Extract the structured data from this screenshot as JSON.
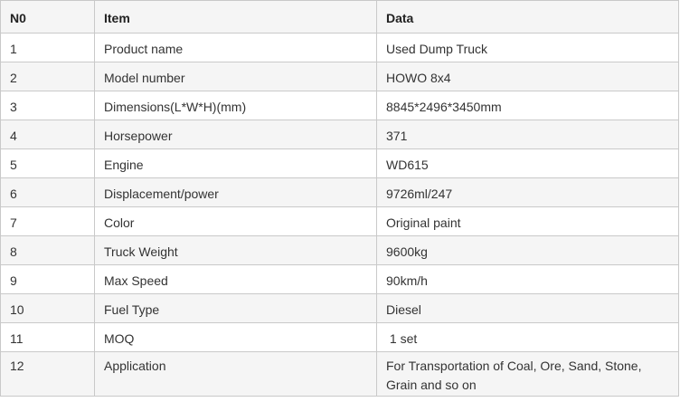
{
  "table": {
    "headers": [
      "N0",
      "Item",
      "Data"
    ],
    "rows": [
      {
        "no": "1",
        "item": "Product name",
        "data": "Used Dump Truck"
      },
      {
        "no": "2",
        "item": "Model number",
        "data": "HOWO 8x4"
      },
      {
        "no": "3",
        "item": "Dimensions(L*W*H)(mm)",
        "data": "8845*2496*3450mm"
      },
      {
        "no": "4",
        "item": "Horsepower",
        "data": "371"
      },
      {
        "no": "5",
        "item": "Engine",
        "data": "WD615"
      },
      {
        "no": "6",
        "item": "Displacement/power",
        "data": "9726ml/247"
      },
      {
        "no": "7",
        "item": "Color",
        "data": "Original paint"
      },
      {
        "no": "8",
        "item": "Truck Weight",
        "data": "9600kg"
      },
      {
        "no": "9",
        "item": "Max Speed",
        "data": "90km/h"
      },
      {
        "no": "10",
        "item": "Fuel Type",
        "data": "Diesel"
      },
      {
        "no": "11",
        "item": "MOQ",
        "data": " 1 set"
      },
      {
        "no": "12",
        "item": "Application",
        "data": "For Transportation of Coal, Ore, Sand, Stone, Grain and so on"
      }
    ]
  }
}
